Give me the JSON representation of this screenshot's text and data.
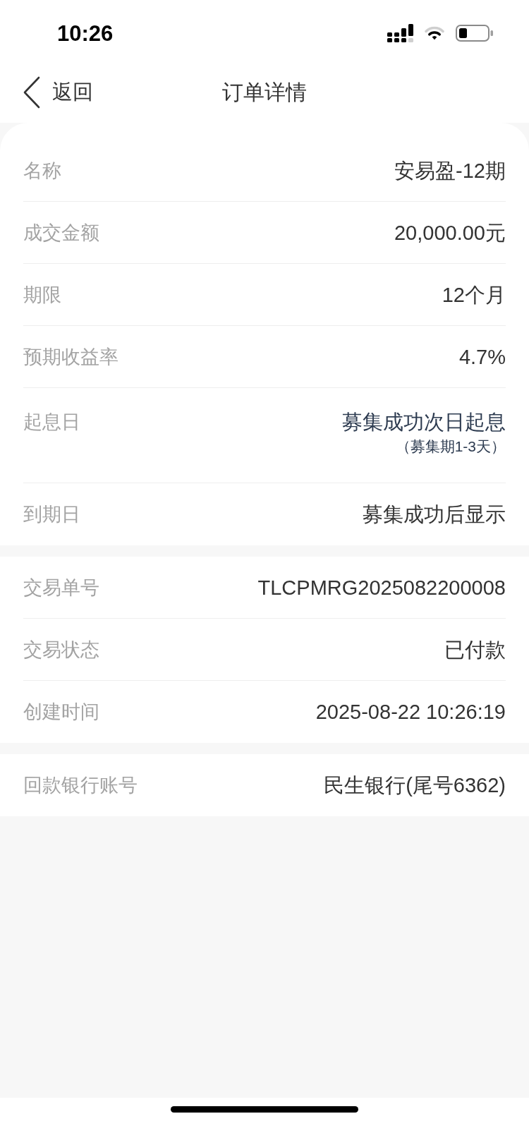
{
  "status_bar": {
    "time": "10:26"
  },
  "nav": {
    "back_label": "返回",
    "title": "订单详情"
  },
  "sections": [
    {
      "rows": [
        {
          "kind": "plain",
          "label": "名称",
          "value": "安易盈-12期"
        },
        {
          "kind": "plain",
          "label": "成交金额",
          "value": "20,000.00元"
        },
        {
          "kind": "plain",
          "label": "期限",
          "value": "12个月"
        },
        {
          "kind": "plain",
          "label": "预期收益率",
          "value": "4.7%"
        },
        {
          "kind": "note",
          "label": "起息日",
          "value": "募集成功次日起息",
          "note": "（募集期1-3天）"
        },
        {
          "kind": "plain",
          "label": "到期日",
          "value": "募集成功后显示"
        }
      ]
    },
    {
      "rows": [
        {
          "kind": "plain",
          "label": "交易单号",
          "value": "TLCPMRG2025082200008"
        },
        {
          "kind": "plain",
          "label": "交易状态",
          "value": "已付款"
        },
        {
          "kind": "plain",
          "label": "创建时间",
          "value": "2025-08-22 10:26:19"
        }
      ]
    },
    {
      "rows": [
        {
          "kind": "plain",
          "label": "回款银行账号",
          "value": "民生银行(尾号6362)"
        }
      ]
    }
  ]
}
